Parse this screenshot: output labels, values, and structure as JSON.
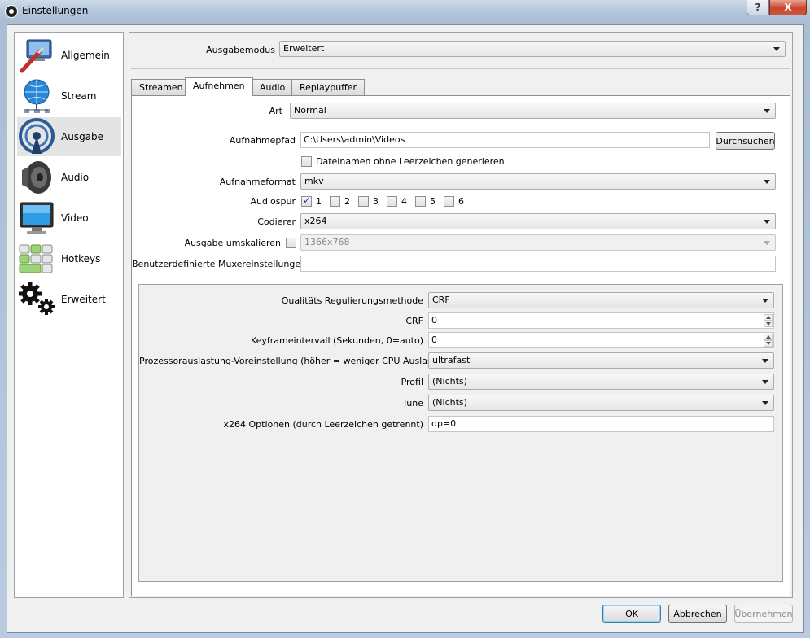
{
  "window": {
    "title": "Einstellungen",
    "help_btn": "?",
    "close_btn": "X"
  },
  "sidebar": {
    "items": [
      {
        "label": "Allgemein",
        "icon": "settings-wizard-icon"
      },
      {
        "label": "Stream",
        "icon": "globe-network-icon"
      },
      {
        "label": "Ausgabe",
        "icon": "broadcast-antenna-icon"
      },
      {
        "label": "Audio",
        "icon": "speaker-icon"
      },
      {
        "label": "Video",
        "icon": "monitor-icon"
      },
      {
        "label": "Hotkeys",
        "icon": "keyboard-icon"
      },
      {
        "label": "Erweitert",
        "icon": "gears-icon"
      }
    ],
    "selected": "Ausgabe"
  },
  "output_mode": {
    "label": "Ausgabemodus",
    "value": "Erweitert"
  },
  "tabs": [
    "Streamen",
    "Aufnehmen",
    "Audio",
    "Replaypuffer"
  ],
  "active_tab": "Aufnehmen",
  "recording": {
    "type_label": "Art",
    "type_value": "Normal",
    "path_label": "Aufnahmepfad",
    "path_value": "C:\\Users\\admin\\Videos",
    "browse_label": "Durchsuchen",
    "nospace_label": "Dateinamen ohne Leerzeichen generieren",
    "nospace_checked": false,
    "format_label": "Aufnahmeformat",
    "format_value": "mkv",
    "audiotrack_label": "Audiospur",
    "tracks": [
      {
        "label": "1",
        "checked": true
      },
      {
        "label": "2",
        "checked": false
      },
      {
        "label": "3",
        "checked": false
      },
      {
        "label": "4",
        "checked": false
      },
      {
        "label": "5",
        "checked": false
      },
      {
        "label": "6",
        "checked": false
      }
    ],
    "encoder_label": "Codierer",
    "encoder_value": "x264",
    "rescale_label": "Ausgabe umskalieren",
    "rescale_checked": false,
    "rescale_value": "1366x768",
    "muxer_label": "Benutzerdefinierte Muxereinstellungen",
    "muxer_value": ""
  },
  "encoder_settings": {
    "rate_control_label": "Qualitäts Regulierungsmethode",
    "rate_control_value": "CRF",
    "crf_label": "CRF",
    "crf_value": "0",
    "keyframe_label": "Keyframeintervall (Sekunden, 0=auto)",
    "keyframe_value": "0",
    "preset_label": "Prozessorauslastung-Voreinstellung (höher = weniger CPU Auslastung)",
    "preset_value": "ultrafast",
    "profile_label": "Profil",
    "profile_value": "(Nichts)",
    "tune_label": "Tune",
    "tune_value": "(Nichts)",
    "options_label": "x264 Optionen (durch Leerzeichen getrennt)",
    "options_value": "qp=0"
  },
  "footer": {
    "ok": "OK",
    "cancel": "Abbrechen",
    "apply": "Übernehmen"
  }
}
